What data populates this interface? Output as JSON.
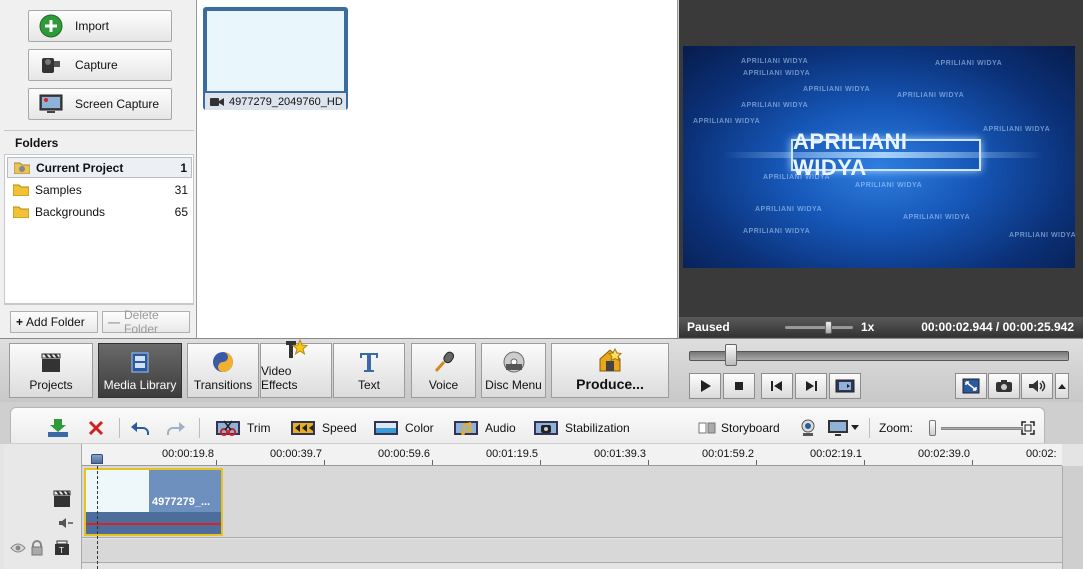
{
  "left_panel": {
    "import_buttons": [
      {
        "label": "Import",
        "icon": "plus-circle-icon"
      },
      {
        "label": "Capture",
        "icon": "camcorder-icon"
      },
      {
        "label": "Screen Capture",
        "icon": "screen-capture-icon"
      }
    ],
    "folders_title": "Folders",
    "folders": [
      {
        "name": "Current Project",
        "count": "1",
        "selected": true
      },
      {
        "name": "Samples",
        "count": "31",
        "selected": false
      },
      {
        "name": "Backgrounds",
        "count": "65",
        "selected": false
      }
    ],
    "add_folder_label": "Add Folder",
    "delete_folder_label": "Delete Folder"
  },
  "media": {
    "items": [
      {
        "name": "4977279_2049760_HD",
        "type_icon": "video-camera-icon"
      }
    ]
  },
  "preview": {
    "title_text": "APRILIANI WIDYA",
    "background_text": "APRILIANI WIDYA",
    "status": "Paused",
    "speed": "1x",
    "current_time": "00:00:02.944",
    "separator": "/",
    "total_time": "00:00:25.942"
  },
  "main_toolbar": {
    "tabs": [
      {
        "label": "Projects",
        "icon": "clapperboard-icon",
        "active": false
      },
      {
        "label": "Media Library",
        "icon": "film-library-icon",
        "active": true
      },
      {
        "label": "Transitions",
        "icon": "transitions-swirl-icon",
        "active": false
      },
      {
        "label": "Video Effects",
        "icon": "video-effects-icon",
        "active": false
      },
      {
        "label": "Text",
        "icon": "text-t-icon",
        "active": false
      },
      {
        "label": "Voice",
        "icon": "microphone-icon",
        "active": false
      },
      {
        "label": "Disc Menu",
        "icon": "disc-menu-icon",
        "active": false
      },
      {
        "label": "Produce...",
        "icon": "produce-icon",
        "active": false
      }
    ]
  },
  "edit_toolbar": {
    "tools": [
      {
        "label": "Trim",
        "icon": "trim-scissors-icon"
      },
      {
        "label": "Speed",
        "icon": "speed-icon"
      },
      {
        "label": "Color",
        "icon": "color-icon"
      },
      {
        "label": "Audio",
        "icon": "audio-icon"
      },
      {
        "label": "Stabilization",
        "icon": "stabilization-icon"
      }
    ],
    "storyboard_label": "Storyboard",
    "zoom_label": "Zoom:"
  },
  "timeline": {
    "ruler_ticks": [
      "00:00:19.8",
      "00:00:39.7",
      "00:00:59.6",
      "00:01:19.5",
      "00:01:39.3",
      "00:01:59.2",
      "00:02:19.1",
      "00:02:39.0",
      "00:02:"
    ],
    "clip_name": "4977279_..."
  },
  "colors": {
    "accent_blue": "#3c6b9e",
    "clip_border": "#e6c320",
    "audio_wave": "#dd2222",
    "preview_bg": "#3a3a3a"
  }
}
